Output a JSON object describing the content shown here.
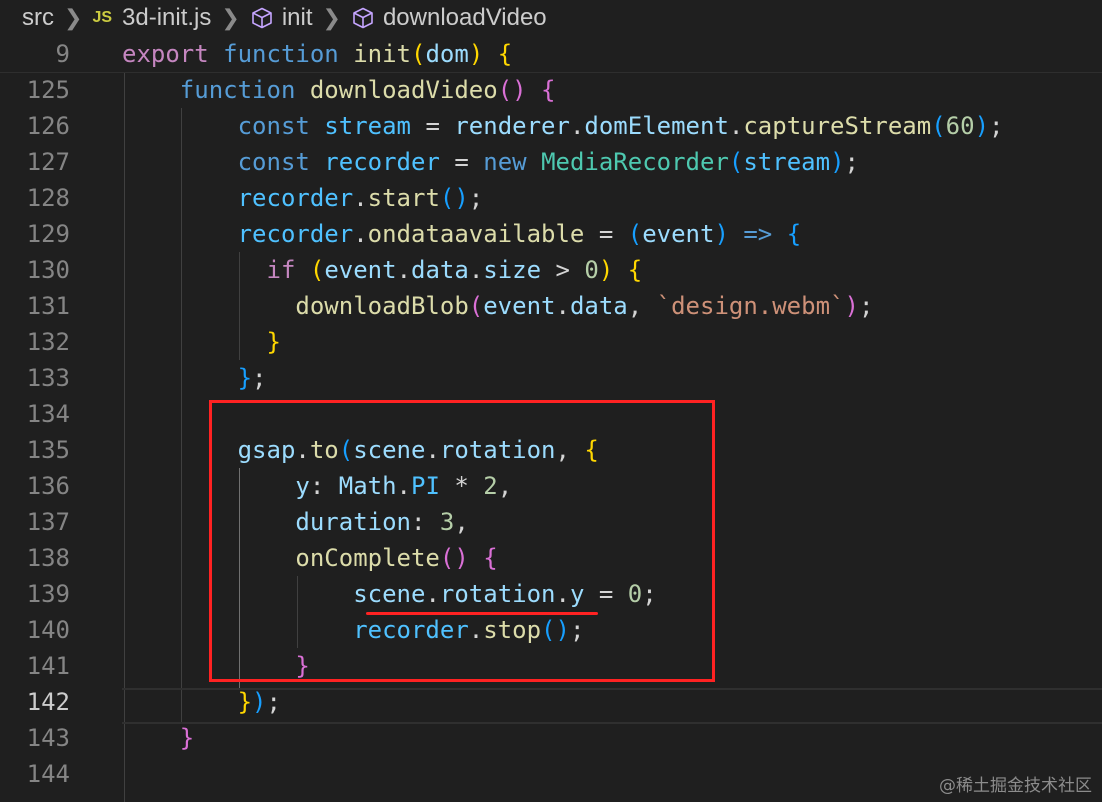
{
  "breadcrumb": {
    "items": [
      "src",
      "3d-init.js",
      "init",
      "downloadVideo"
    ],
    "file_badge": "JS"
  },
  "editor": {
    "current_line": 142,
    "lines": [
      {
        "num": "9",
        "sticky": true,
        "tokens": [
          {
            "t": "export",
            "c": "ctl"
          },
          {
            "t": " ",
            "c": "pl"
          },
          {
            "t": "function",
            "c": "kw"
          },
          {
            "t": " ",
            "c": "pl"
          },
          {
            "t": "init",
            "c": "fn"
          },
          {
            "t": "(",
            "c": "b1"
          },
          {
            "t": "dom",
            "c": "var"
          },
          {
            "t": ")",
            "c": "b1"
          },
          {
            "t": " ",
            "c": "pl"
          },
          {
            "t": "{",
            "c": "b1"
          }
        ]
      },
      {
        "num": "125",
        "tokens": [
          {
            "t": "    ",
            "c": "pl"
          },
          {
            "t": "function",
            "c": "kw"
          },
          {
            "t": " ",
            "c": "pl"
          },
          {
            "t": "downloadVideo",
            "c": "fn"
          },
          {
            "t": "()",
            "c": "b2"
          },
          {
            "t": " ",
            "c": "pl"
          },
          {
            "t": "{",
            "c": "b2"
          }
        ]
      },
      {
        "num": "126",
        "tokens": [
          {
            "t": "        ",
            "c": "pl"
          },
          {
            "t": "const",
            "c": "kw"
          },
          {
            "t": " ",
            "c": "pl"
          },
          {
            "t": "stream",
            "c": "cst"
          },
          {
            "t": " = ",
            "c": "pl"
          },
          {
            "t": "renderer",
            "c": "var"
          },
          {
            "t": ".",
            "c": "pl"
          },
          {
            "t": "domElement",
            "c": "var"
          },
          {
            "t": ".",
            "c": "pl"
          },
          {
            "t": "captureStream",
            "c": "fn"
          },
          {
            "t": "(",
            "c": "b3"
          },
          {
            "t": "60",
            "c": "num"
          },
          {
            "t": ")",
            "c": "b3"
          },
          {
            "t": ";",
            "c": "pl"
          }
        ]
      },
      {
        "num": "127",
        "tokens": [
          {
            "t": "        ",
            "c": "pl"
          },
          {
            "t": "const",
            "c": "kw"
          },
          {
            "t": " ",
            "c": "pl"
          },
          {
            "t": "recorder",
            "c": "cst"
          },
          {
            "t": " = ",
            "c": "pl"
          },
          {
            "t": "new",
            "c": "kw"
          },
          {
            "t": " ",
            "c": "pl"
          },
          {
            "t": "MediaRecorder",
            "c": "cls"
          },
          {
            "t": "(",
            "c": "b3"
          },
          {
            "t": "stream",
            "c": "cst"
          },
          {
            "t": ")",
            "c": "b3"
          },
          {
            "t": ";",
            "c": "pl"
          }
        ]
      },
      {
        "num": "128",
        "tokens": [
          {
            "t": "        ",
            "c": "pl"
          },
          {
            "t": "recorder",
            "c": "cst"
          },
          {
            "t": ".",
            "c": "pl"
          },
          {
            "t": "start",
            "c": "fn"
          },
          {
            "t": "()",
            "c": "b3"
          },
          {
            "t": ";",
            "c": "pl"
          }
        ]
      },
      {
        "num": "129",
        "tokens": [
          {
            "t": "        ",
            "c": "pl"
          },
          {
            "t": "recorder",
            "c": "cst"
          },
          {
            "t": ".",
            "c": "pl"
          },
          {
            "t": "ondataavailable",
            "c": "fn"
          },
          {
            "t": " = ",
            "c": "pl"
          },
          {
            "t": "(",
            "c": "b3"
          },
          {
            "t": "event",
            "c": "var"
          },
          {
            "t": ")",
            "c": "b3"
          },
          {
            "t": " ",
            "c": "pl"
          },
          {
            "t": "=>",
            "c": "kw"
          },
          {
            "t": " ",
            "c": "pl"
          },
          {
            "t": "{",
            "c": "b3"
          }
        ]
      },
      {
        "num": "130",
        "tokens": [
          {
            "t": "          ",
            "c": "pl"
          },
          {
            "t": "if",
            "c": "ctl"
          },
          {
            "t": " ",
            "c": "pl"
          },
          {
            "t": "(",
            "c": "b1"
          },
          {
            "t": "event",
            "c": "var"
          },
          {
            "t": ".",
            "c": "pl"
          },
          {
            "t": "data",
            "c": "var"
          },
          {
            "t": ".",
            "c": "pl"
          },
          {
            "t": "size",
            "c": "var"
          },
          {
            "t": " > ",
            "c": "pl"
          },
          {
            "t": "0",
            "c": "num"
          },
          {
            "t": ")",
            "c": "b1"
          },
          {
            "t": " ",
            "c": "pl"
          },
          {
            "t": "{",
            "c": "b1"
          }
        ]
      },
      {
        "num": "131",
        "tokens": [
          {
            "t": "            ",
            "c": "pl"
          },
          {
            "t": "downloadBlob",
            "c": "fn"
          },
          {
            "t": "(",
            "c": "b2"
          },
          {
            "t": "event",
            "c": "var"
          },
          {
            "t": ".",
            "c": "pl"
          },
          {
            "t": "data",
            "c": "var"
          },
          {
            "t": ", ",
            "c": "pl"
          },
          {
            "t": "`design.webm`",
            "c": "str"
          },
          {
            "t": ")",
            "c": "b2"
          },
          {
            "t": ";",
            "c": "pl"
          }
        ]
      },
      {
        "num": "132",
        "tokens": [
          {
            "t": "          ",
            "c": "pl"
          },
          {
            "t": "}",
            "c": "b1"
          }
        ]
      },
      {
        "num": "133",
        "tokens": [
          {
            "t": "        ",
            "c": "pl"
          },
          {
            "t": "}",
            "c": "b3"
          },
          {
            "t": ";",
            "c": "pl"
          }
        ]
      },
      {
        "num": "134",
        "tokens": []
      },
      {
        "num": "135",
        "tokens": [
          {
            "t": "        ",
            "c": "pl"
          },
          {
            "t": "gsap",
            "c": "var"
          },
          {
            "t": ".",
            "c": "pl"
          },
          {
            "t": "to",
            "c": "fn"
          },
          {
            "t": "(",
            "c": "b3"
          },
          {
            "t": "scene",
            "c": "var"
          },
          {
            "t": ".",
            "c": "pl"
          },
          {
            "t": "rotation",
            "c": "var"
          },
          {
            "t": ", ",
            "c": "pl"
          },
          {
            "t": "{",
            "c": "b1"
          }
        ]
      },
      {
        "num": "136",
        "tokens": [
          {
            "t": "            ",
            "c": "pl"
          },
          {
            "t": "y",
            "c": "var"
          },
          {
            "t": ": ",
            "c": "pl"
          },
          {
            "t": "Math",
            "c": "var"
          },
          {
            "t": ".",
            "c": "pl"
          },
          {
            "t": "PI",
            "c": "cst"
          },
          {
            "t": " * ",
            "c": "pl"
          },
          {
            "t": "2",
            "c": "num"
          },
          {
            "t": ",",
            "c": "pl"
          }
        ]
      },
      {
        "num": "137",
        "tokens": [
          {
            "t": "            ",
            "c": "pl"
          },
          {
            "t": "duration",
            "c": "var"
          },
          {
            "t": ": ",
            "c": "pl"
          },
          {
            "t": "3",
            "c": "num"
          },
          {
            "t": ",",
            "c": "pl"
          }
        ]
      },
      {
        "num": "138",
        "tokens": [
          {
            "t": "            ",
            "c": "pl"
          },
          {
            "t": "onComplete",
            "c": "fn"
          },
          {
            "t": "()",
            "c": "b2"
          },
          {
            "t": " ",
            "c": "pl"
          },
          {
            "t": "{",
            "c": "b2"
          }
        ]
      },
      {
        "num": "139",
        "tokens": [
          {
            "t": "                ",
            "c": "pl"
          },
          {
            "t": "scene",
            "c": "var"
          },
          {
            "t": ".",
            "c": "pl"
          },
          {
            "t": "rotation",
            "c": "var"
          },
          {
            "t": ".",
            "c": "pl"
          },
          {
            "t": "y",
            "c": "var"
          },
          {
            "t": " = ",
            "c": "pl"
          },
          {
            "t": "0",
            "c": "num"
          },
          {
            "t": ";",
            "c": "pl"
          }
        ]
      },
      {
        "num": "140",
        "tokens": [
          {
            "t": "                ",
            "c": "pl"
          },
          {
            "t": "recorder",
            "c": "cst"
          },
          {
            "t": ".",
            "c": "pl"
          },
          {
            "t": "stop",
            "c": "fn"
          },
          {
            "t": "()",
            "c": "b3"
          },
          {
            "t": ";",
            "c": "pl"
          }
        ]
      },
      {
        "num": "141",
        "tokens": [
          {
            "t": "            ",
            "c": "pl"
          },
          {
            "t": "}",
            "c": "b2"
          }
        ]
      },
      {
        "num": "142",
        "tokens": [
          {
            "t": "        ",
            "c": "pl"
          },
          {
            "t": "}",
            "c": "b1"
          },
          {
            "t": ")",
            "c": "b3"
          },
          {
            "t": ";",
            "c": "pl"
          }
        ]
      },
      {
        "num": "143",
        "tokens": [
          {
            "t": "    ",
            "c": "pl"
          },
          {
            "t": "}",
            "c": "b2"
          }
        ]
      },
      {
        "num": "144",
        "tokens": []
      }
    ]
  },
  "watermark": "@稀土掘金技术社区"
}
